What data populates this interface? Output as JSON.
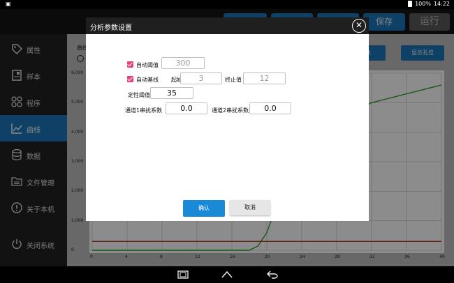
{
  "status_bar": {
    "battery": "100%",
    "time": "14:22"
  },
  "toolbar": {
    "save_label": "保存",
    "run_label": "运行"
  },
  "sidebar": {
    "items": [
      {
        "label": "属性",
        "icon": "tag-icon"
      },
      {
        "label": "样本",
        "icon": "sample-icon"
      },
      {
        "label": "程序",
        "icon": "program-icon"
      },
      {
        "label": "曲线",
        "icon": "chart-icon"
      },
      {
        "label": "数据",
        "icon": "database-icon"
      },
      {
        "label": "文件管理",
        "icon": "folder-icon"
      },
      {
        "label": "关于本机",
        "icon": "info-icon"
      },
      {
        "label": "关闭系统",
        "icon": "power-icon"
      }
    ],
    "active_index": 3
  },
  "main": {
    "header_label": "曲线",
    "params_button": "参数",
    "show_wells_button": "显示孔位"
  },
  "chart_data": {
    "type": "line",
    "title": "",
    "xlabel": "",
    "ylabel": "",
    "xlim": [
      0,
      40
    ],
    "ylim": [
      0,
      6000
    ],
    "x_ticks": [
      "0",
      "4",
      "8",
      "12",
      "16",
      "20",
      "24",
      "28",
      "32",
      "36",
      "40"
    ],
    "y_ticks": [
      "0",
      "1,000",
      "2,000",
      "3,000",
      "4,000",
      "5,000",
      "6,000"
    ],
    "grid": true,
    "series": [
      {
        "color": "#2aa02a",
        "x": [
          0,
          16,
          18,
          19,
          20,
          21,
          22,
          23,
          24,
          26,
          28,
          30,
          32,
          34,
          36,
          38,
          40
        ],
        "y": [
          0,
          0,
          0,
          150,
          600,
          1400,
          2300,
          3000,
          3500,
          4000,
          4400,
          4700,
          5000,
          5150,
          5300,
          5450,
          5600
        ]
      },
      {
        "color": "#c0392b",
        "x": [
          0,
          40
        ],
        "y": [
          300,
          300
        ]
      }
    ]
  },
  "dialog": {
    "title": "分析参数设置",
    "auto_threshold": {
      "label": "自动阈值",
      "checked": true,
      "value": "300"
    },
    "auto_baseline": {
      "label": "自动基线",
      "checked": true,
      "start_label": "起始值",
      "start_value": "3",
      "stop_label": "终止值",
      "stop_value": "12"
    },
    "qualitative_threshold": {
      "label": "定性阈值",
      "value": "35"
    },
    "ch1_crosstalk": {
      "label": "通道1串扰系数",
      "value": "0.0"
    },
    "ch2_crosstalk": {
      "label": "通道2串扰系数",
      "value": "0.0"
    },
    "confirm_label": "确认",
    "cancel_label": "取消"
  }
}
